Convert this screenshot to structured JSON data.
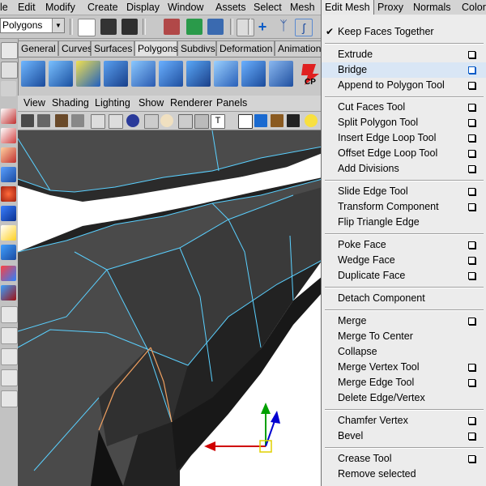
{
  "menubar": {
    "items": [
      {
        "label": "le"
      },
      {
        "label": "Edit"
      },
      {
        "label": "Modify"
      },
      {
        "label": "Create"
      },
      {
        "label": "Display"
      },
      {
        "label": "Window"
      },
      {
        "label": "Assets"
      },
      {
        "label": "Select"
      },
      {
        "label": "Mesh"
      },
      {
        "label": "Edit Mesh"
      },
      {
        "label": "Proxy"
      },
      {
        "label": "Normals"
      },
      {
        "label": "Color"
      }
    ],
    "active": "Edit Mesh"
  },
  "toolbar": {
    "mode_value": "Polygons"
  },
  "shelf": {
    "tabs": [
      {
        "label": "General"
      },
      {
        "label": "Curves"
      },
      {
        "label": "Surfaces"
      },
      {
        "label": "Polygons"
      },
      {
        "label": "Subdivs"
      },
      {
        "label": "Deformation"
      },
      {
        "label": "Animation"
      }
    ],
    "selected_tab": "Polygons",
    "cp_label": "CP"
  },
  "panel_menu": {
    "items": [
      {
        "label": "View"
      },
      {
        "label": "Shading"
      },
      {
        "label": "Lighting"
      },
      {
        "label": "Show"
      },
      {
        "label": "Renderer"
      },
      {
        "label": "Panels"
      }
    ]
  },
  "edit_mesh_menu": {
    "groups": [
      {
        "items": [
          {
            "label": "Keep Faces Together",
            "checked": true,
            "option_box": false
          }
        ]
      },
      {
        "items": [
          {
            "label": "Extrude",
            "option_box": true
          },
          {
            "label": "Bridge",
            "option_box": true,
            "highlighted": true
          },
          {
            "label": "Append to Polygon Tool",
            "option_box": true
          }
        ]
      },
      {
        "items": [
          {
            "label": "Cut Faces Tool",
            "option_box": true
          },
          {
            "label": "Split Polygon Tool",
            "option_box": true
          },
          {
            "label": "Insert Edge Loop Tool",
            "option_box": true
          },
          {
            "label": "Offset Edge Loop Tool",
            "option_box": true
          },
          {
            "label": "Add Divisions",
            "option_box": true
          }
        ]
      },
      {
        "items": [
          {
            "label": "Slide Edge Tool",
            "option_box": true
          },
          {
            "label": "Transform Component",
            "option_box": true
          },
          {
            "label": "Flip Triangle Edge",
            "option_box": false
          }
        ]
      },
      {
        "items": [
          {
            "label": "Poke Face",
            "option_box": true
          },
          {
            "label": "Wedge Face",
            "option_box": true
          },
          {
            "label": "Duplicate Face",
            "option_box": true
          }
        ]
      },
      {
        "items": [
          {
            "label": "Detach Component",
            "option_box": false
          }
        ]
      },
      {
        "items": [
          {
            "label": "Merge",
            "option_box": true
          },
          {
            "label": "Merge To Center",
            "option_box": false
          },
          {
            "label": "Collapse",
            "option_box": false
          },
          {
            "label": "Merge Vertex Tool",
            "option_box": true
          },
          {
            "label": "Merge Edge Tool",
            "option_box": true
          },
          {
            "label": "Delete Edge/Vertex",
            "option_box": false
          }
        ]
      },
      {
        "items": [
          {
            "label": "Chamfer Vertex",
            "option_box": true
          },
          {
            "label": "Bevel",
            "option_box": true
          }
        ]
      },
      {
        "items": [
          {
            "label": "Crease Tool",
            "option_box": true
          },
          {
            "label": "Remove selected",
            "option_box": false
          }
        ]
      }
    ]
  },
  "colors": {
    "menu_bg": "#ececec",
    "highlight": "#d9e6f5",
    "mesh_face": "#4a4a4a",
    "mesh_edge": "#5ad0ff",
    "selected_edge": "#f0a060",
    "manip_x": "#d00000",
    "manip_y": "#00a000",
    "manip_z": "#0000d0"
  }
}
